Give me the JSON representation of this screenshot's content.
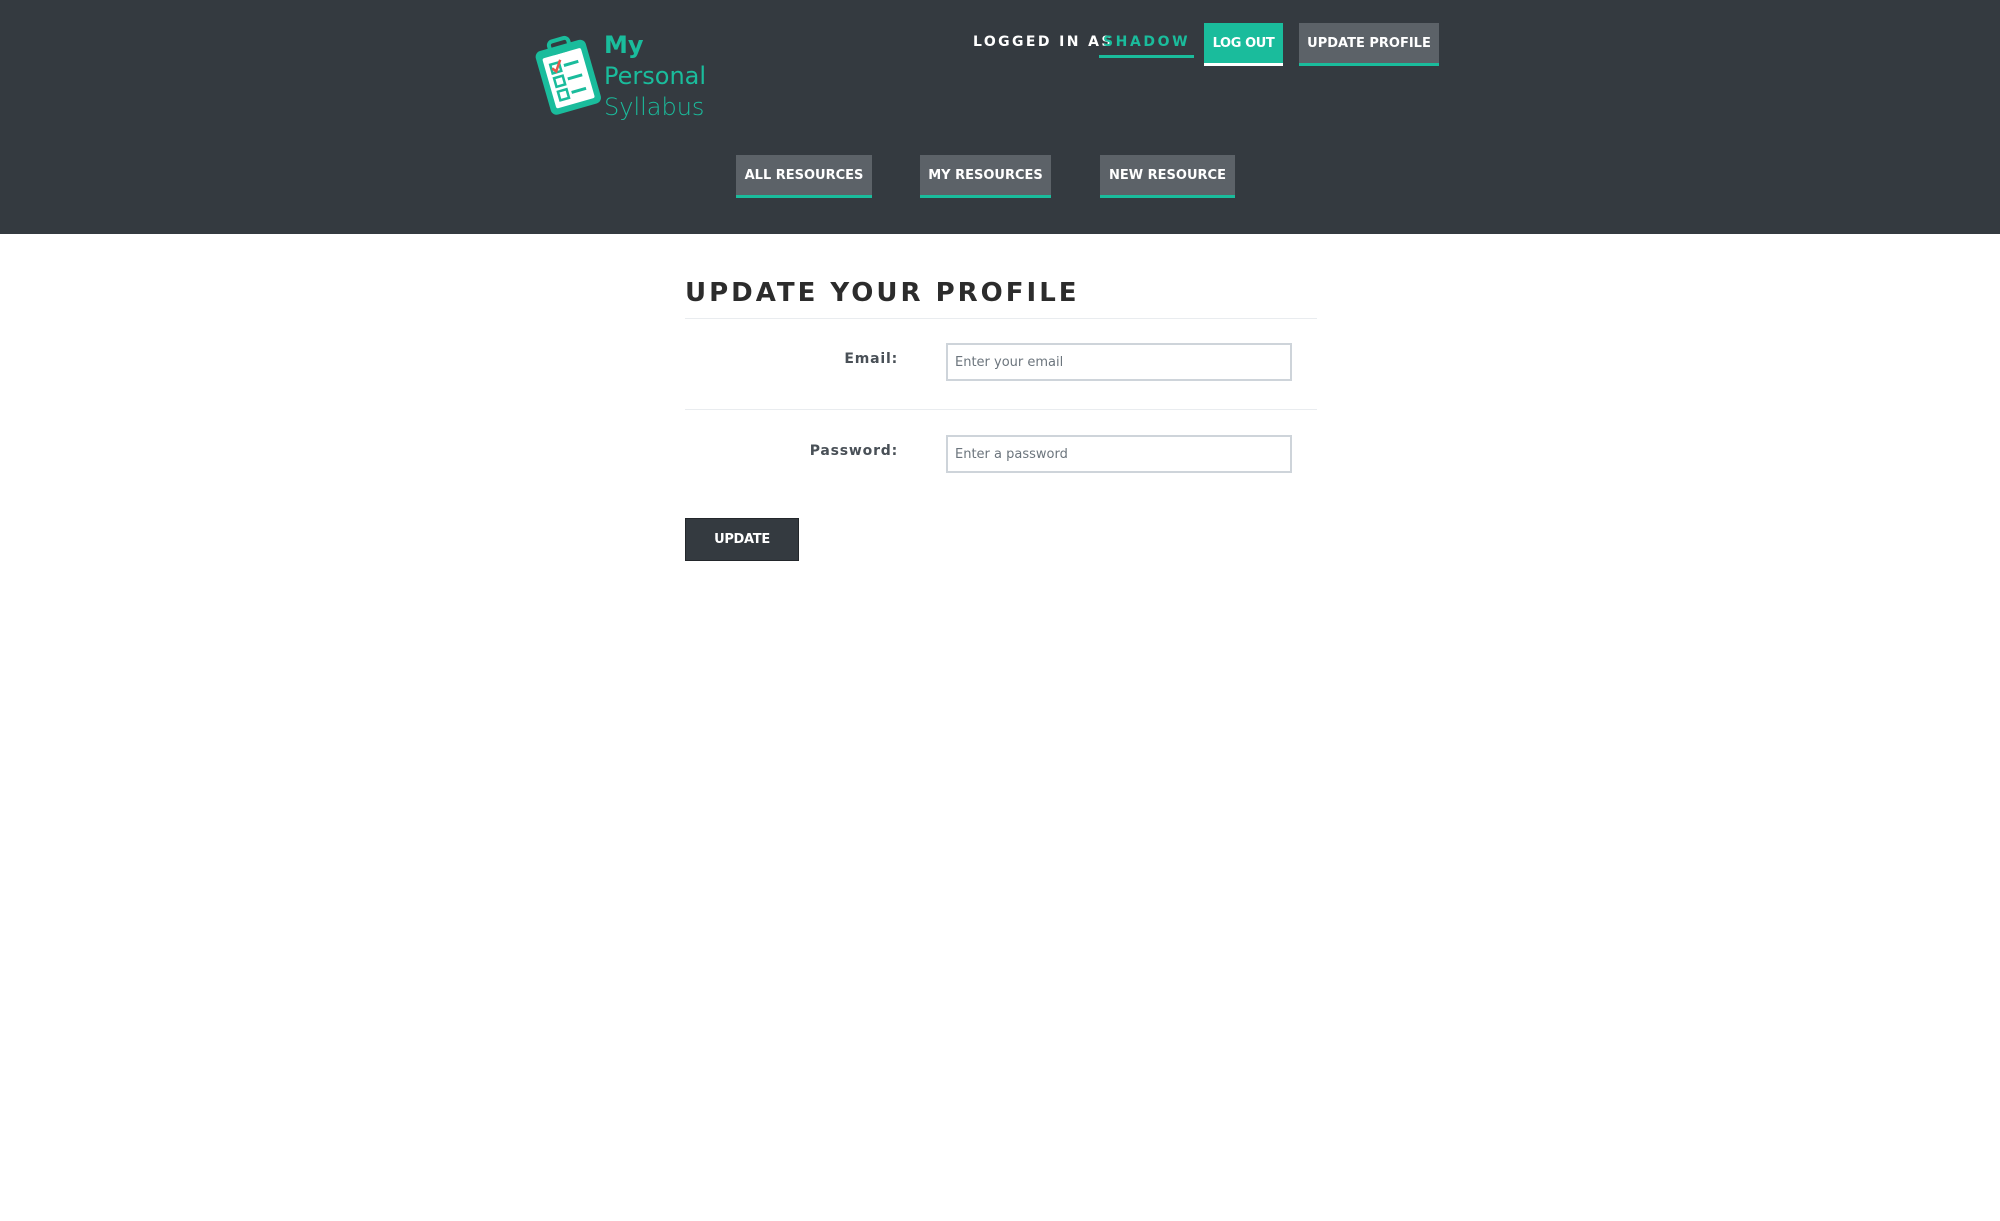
{
  "header": {
    "logo": {
      "line1": "My",
      "line2": "Personal",
      "line3": "Syllabus",
      "icon": "clipboard-checklist-icon"
    },
    "logged_in_label": "LOGGED IN AS",
    "username": "SHADOW",
    "logout_label": "LOG OUT",
    "update_profile_label": "UPDATE PROFILE"
  },
  "nav": {
    "items": [
      {
        "label": "ALL RESOURCES"
      },
      {
        "label": "MY RESOURCES"
      },
      {
        "label": "NEW RESOURCE"
      }
    ]
  },
  "form": {
    "title": "UPDATE YOUR PROFILE",
    "email_label": "Email:",
    "email_placeholder": "Enter your email",
    "email_value": "",
    "password_label": "Password:",
    "password_placeholder": "Enter a password",
    "password_value": "",
    "submit_label": "UPDATE"
  },
  "colors": {
    "header_bg": "#343a40",
    "accent": "#1abc9c",
    "nav_button_bg": "#5c6268",
    "submit_bg": "#343a40"
  }
}
